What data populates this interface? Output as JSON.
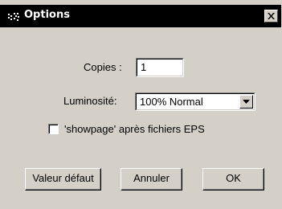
{
  "window": {
    "title": "Options",
    "app_icon": "app-icon",
    "close_icon": "close-icon",
    "background_color": "#d4d0c8",
    "titlebar_color": "#000000"
  },
  "form": {
    "copies_label": "Copies :",
    "copies_value": "1",
    "luminosity_label": "Luminosité:",
    "luminosity_selected": "100% Normal",
    "dropdown_icon": "chevron-down-icon",
    "showpage_label": "'showpage' après fichiers EPS",
    "showpage_checked": false
  },
  "buttons": {
    "default_label": "Valeur défaut",
    "cancel_label": "Annuler",
    "ok_label": "OK"
  }
}
